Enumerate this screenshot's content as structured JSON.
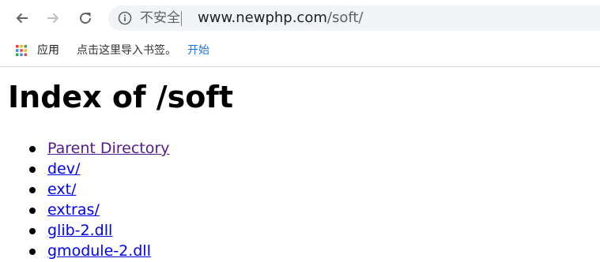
{
  "browser": {
    "insecure_label": "不安全",
    "url_host": "www.newphp.com",
    "url_path": "/soft/"
  },
  "bookmarks_bar": {
    "apps_label": "应用",
    "hint_text": "点击这里导入书签。",
    "hint_link": "开始"
  },
  "page": {
    "title": "Index of /soft",
    "items": [
      {
        "label": "Parent Directory",
        "visited": true
      },
      {
        "label": "dev/",
        "visited": false
      },
      {
        "label": "ext/",
        "visited": false
      },
      {
        "label": "extras/",
        "visited": false
      },
      {
        "label": "glib-2.dll",
        "visited": false
      },
      {
        "label": "gmodule-2.dll",
        "visited": false
      }
    ]
  }
}
